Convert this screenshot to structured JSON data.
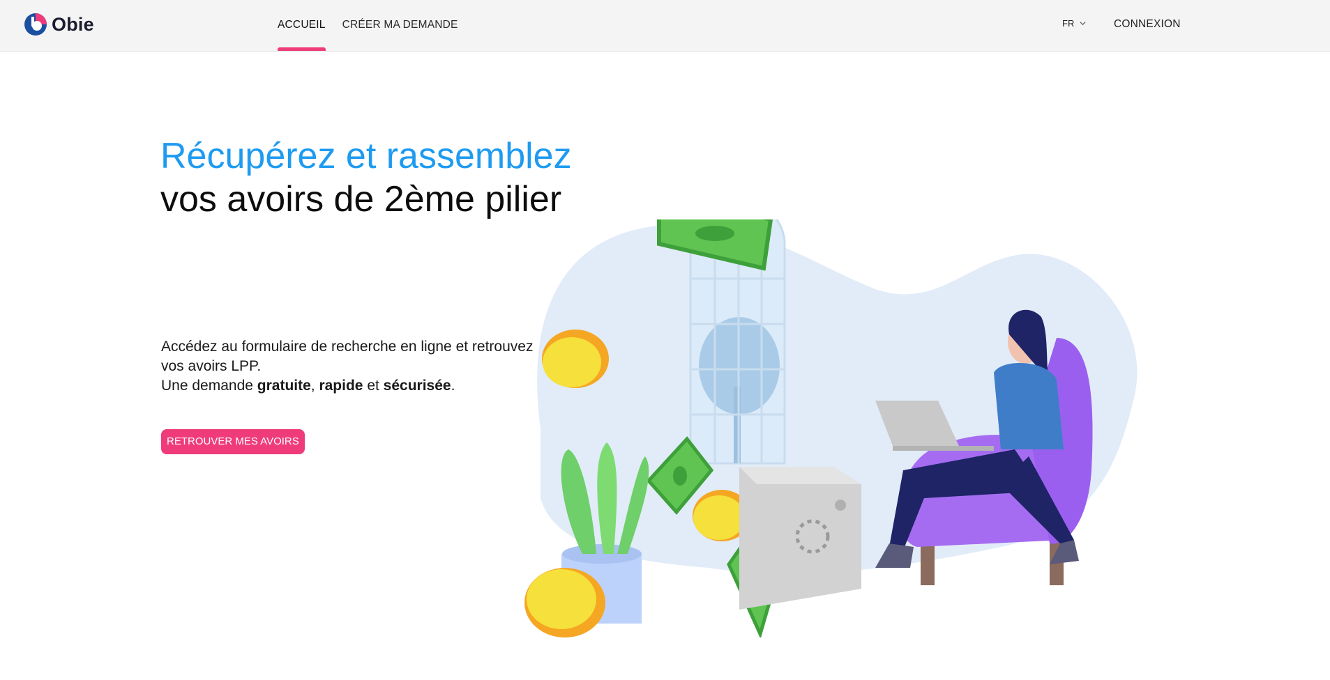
{
  "header": {
    "logo_text": "Obie",
    "nav": [
      {
        "label": "ACCUEIL",
        "active": true
      },
      {
        "label": "CRÉER MA DEMANDE",
        "active": false
      }
    ],
    "language": "FR",
    "login_label": "CONNEXION"
  },
  "hero": {
    "title_line1": "Récupérez et rassemblez",
    "title_line2": "vos avoirs de 2ème pilier",
    "description_line1": "Accédez au formulaire de recherche en ligne et retrouvez vos avoirs LPP.",
    "description_line2_prefix": "Une demande ",
    "emphasis_1": "gratuite",
    "separator_1": ", ",
    "emphasis_2": "rapide",
    "separator_2": " et ",
    "emphasis_3": "sécurisée",
    "description_line2_suffix": ".",
    "cta_label": "RETROUVER MES AVOIRS"
  },
  "colors": {
    "accent": "#ef3b7a",
    "title_blue": "#1e9bf0",
    "header_bg": "#f4f4f4"
  },
  "icons": [
    "obie-logo-icon",
    "chevron-down-icon"
  ]
}
